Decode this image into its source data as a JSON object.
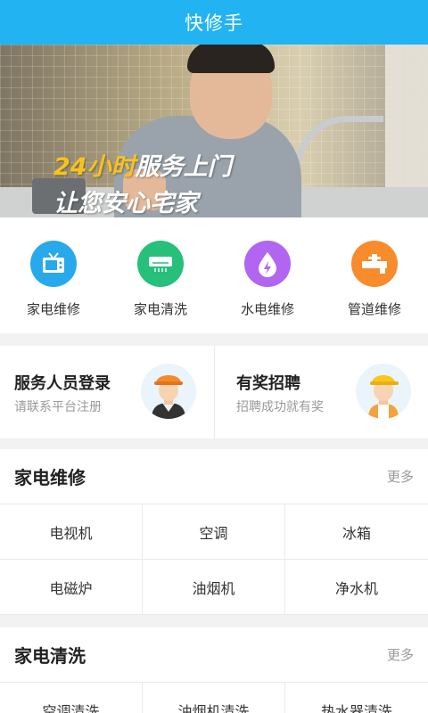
{
  "app": {
    "title": "快修手"
  },
  "banner": {
    "line1_accent": "24小时",
    "line1_rest": "服务上门",
    "line2": "让您安心宅家",
    "slide_count": 3,
    "active_slide": 2
  },
  "categories": [
    {
      "label": "家电维修",
      "icon": "tv-icon",
      "color": "#27a9ec"
    },
    {
      "label": "家电清洗",
      "icon": "air-conditioner-icon",
      "color": "#27c07a"
    },
    {
      "label": "水电维修",
      "icon": "water-drop-bolt-icon",
      "color": "#b165f0"
    },
    {
      "label": "管道维修",
      "icon": "pipe-faucet-icon",
      "color": "#f88b2b"
    }
  ],
  "promos": [
    {
      "title": "服务人员登录",
      "subtitle": "请联系平台注册",
      "icon": "worker-avatar-icon"
    },
    {
      "title": "有奖招聘",
      "subtitle": "招聘成功就有奖",
      "icon": "worker-avatar-icon"
    }
  ],
  "sections": [
    {
      "title": "家电维修",
      "more": "更多",
      "items": [
        "电视机",
        "空调",
        "冰箱",
        "电磁炉",
        "油烟机",
        "净水机"
      ]
    },
    {
      "title": "家电清洗",
      "more": "更多",
      "items": [
        "空调清洗",
        "油烟机清洗",
        "热水器清洗"
      ]
    }
  ],
  "colors": {
    "header": "#22b3f2",
    "accent_yellow": "#f9c21c"
  }
}
